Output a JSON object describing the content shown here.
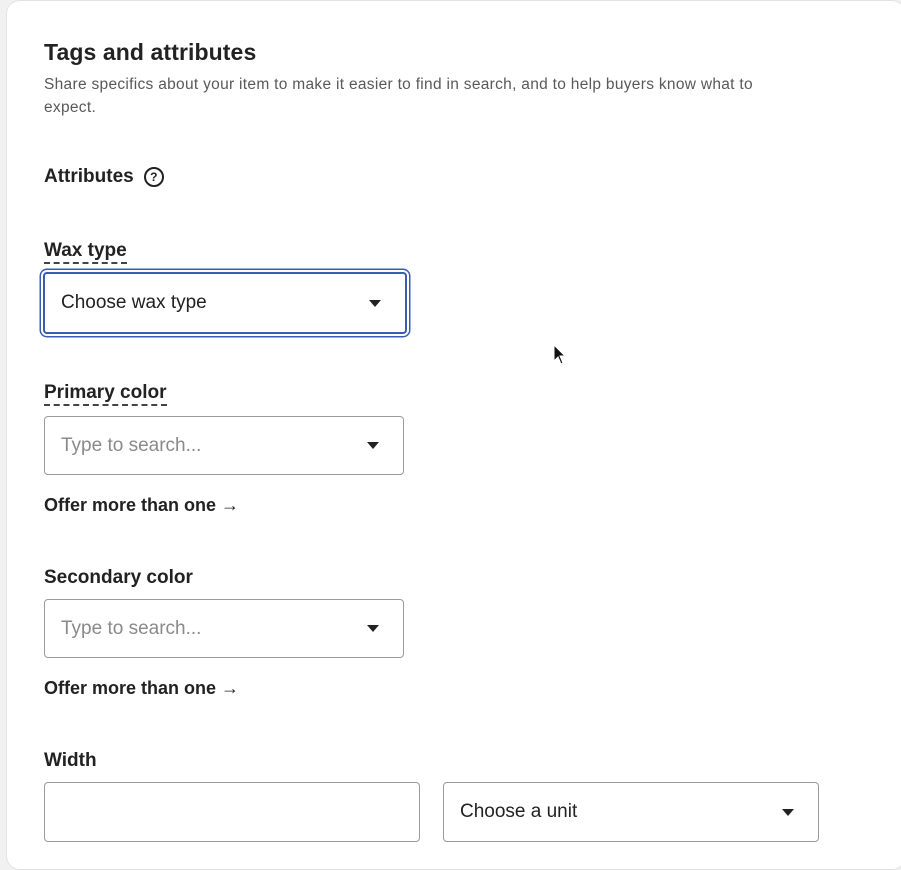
{
  "section": {
    "title": "Tags and attributes",
    "description": "Share specifics about your item to make it easier to find in search, and to help buyers know what to expect."
  },
  "attributes": {
    "heading": "Attributes",
    "help_icon": "question-circle-icon"
  },
  "wax_type": {
    "label": "Wax type",
    "value": "Choose wax type",
    "caret_icon": "caret-down-icon"
  },
  "primary_color": {
    "label": "Primary color",
    "placeholder": "Type to search...",
    "offer_more": "Offer more than one →"
  },
  "secondary_color": {
    "label": "Secondary color",
    "placeholder": "Type to search...",
    "offer_more": "Offer more than one →"
  },
  "width": {
    "label": "Width",
    "value": "",
    "unit_value": "Choose a unit"
  },
  "colors": {
    "focus_ring": "#3b5bb5",
    "text": "#222222",
    "muted": "#595959"
  }
}
